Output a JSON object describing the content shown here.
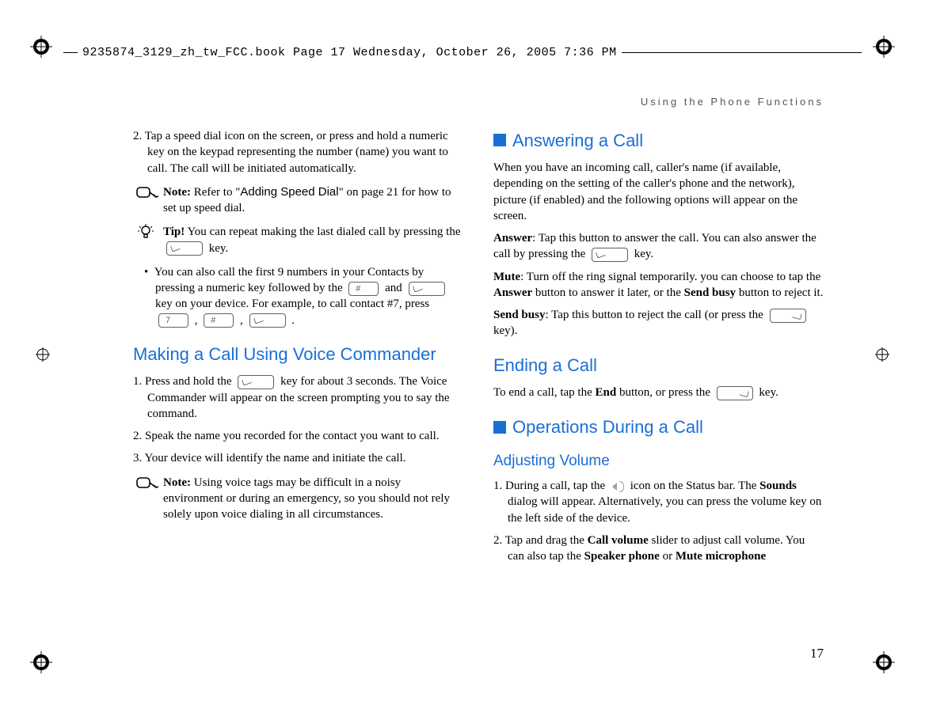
{
  "header": "9235874_3129_zh_tw_FCC.book  Page 17  Wednesday, October 26, 2005  7:36 PM",
  "running_head": "Using the Phone Functions",
  "page_number": "17",
  "left": {
    "step2": "2. Tap a speed dial icon on the screen, or press and hold a numeric key on the keypad representing the number (name) you want to call. The call will be initiated automatically.",
    "note_label": "Note:",
    "note_text_pre": " Refer to \"",
    "note_link": "Adding Speed Dial",
    "note_text_post": "\" on page 21 for how to set up speed dial.",
    "tip_label": "Tip!",
    "tip_text_pre": " You can repeat making the last dialed call by pressing the ",
    "tip_text_post": " key.",
    "bullet_pre": "You can also call the first 9 numbers in your Contacts by pressing a numeric key followed by the ",
    "bullet_mid": " and ",
    "bullet_mid2": " key on your device. For example, to call contact #7, press ",
    "h2_voice": "Making a Call Using Voice Commander",
    "voice_1_pre": "1. Press and hold the ",
    "voice_1_post": " key for about 3 seconds. The Voice Commander will appear on the screen prompting you to say the command.",
    "voice_2": "2. Speak the name you recorded for the contact you want to call.",
    "voice_3": "3. Your device will identify the name and initiate the call.",
    "note2_label": "Note:",
    "note2_text": " Using voice tags may be difficult in a noisy environment or during an emergency, so you should not rely solely upon voice dialing in all circumstances.",
    "key_hash": "#",
    "key_7": "7"
  },
  "right": {
    "h1_answer": "Answering a Call",
    "answer_intro": "When you have an incoming call, caller's name (if available, depending on the setting of the caller's phone and the network), picture (if enabled) and the following options will appear on the screen.",
    "answer_label": "Answer",
    "answer_text_pre": ": Tap this button to answer the call. You can also answer the call by pressing the ",
    "answer_text_post": " key.",
    "mute_label": "Mute",
    "mute_text_pre": ": Turn off the ring signal temporarily. you can choose to tap the ",
    "mute_answer_b": "Answer",
    "mute_text_mid": " button to answer it later, or the ",
    "mute_sendbusy_b": "Send busy",
    "mute_text_post": " button to reject it.",
    "sendbusy_label": "Send busy",
    "sendbusy_text_pre": ": Tap this button to reject the call (or press the ",
    "sendbusy_text_post": " key).",
    "h2_ending": "Ending a Call",
    "ending_pre": "To end a call, tap the ",
    "ending_b": "End",
    "ending_mid": " button, or press the ",
    "ending_post": " key.",
    "h1_ops": "Operations During a Call",
    "h3_vol": "Adjusting Volume",
    "vol_1_pre": "1. During a call, tap the ",
    "vol_1_mid": " icon on the Status bar. The ",
    "vol_1_b": "Sounds",
    "vol_1_post": " dialog will appear. Alternatively, you can press the volume key on the left side of the device.",
    "vol_2_pre": "2. Tap and drag the ",
    "vol_2_b1": "Call volume",
    "vol_2_mid": " slider to adjust call volume. You can also tap the ",
    "vol_2_b2": "Speaker phone",
    "vol_2_or": " or ",
    "vol_2_b3": "Mute microphone"
  }
}
